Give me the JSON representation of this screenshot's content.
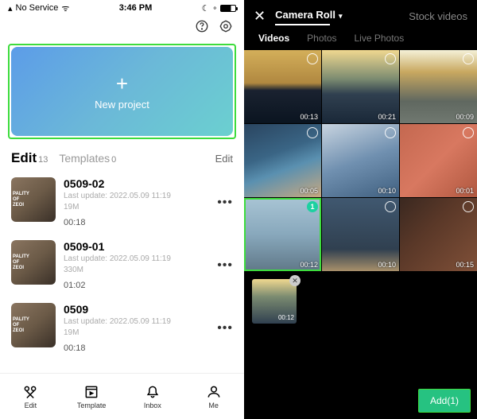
{
  "statusbar": {
    "carrier": "No Service",
    "time": "3:46 PM"
  },
  "new_project_label": "New project",
  "tabs": {
    "edit": "Edit",
    "edit_count": "13",
    "templates": "Templates",
    "templates_count": "0",
    "edit_btn": "Edit"
  },
  "projects": [
    {
      "title": "0509-02",
      "updated": "Last update: 2022.05.09 11:19",
      "size": "19M",
      "duration": "00:18"
    },
    {
      "title": "0509-01",
      "updated": "Last update: 2022.05.09 11:19",
      "size": "330M",
      "duration": "01:02"
    },
    {
      "title": "0509",
      "updated": "Last update: 2022.05.09 11:19",
      "size": "19M",
      "duration": "00:18"
    }
  ],
  "nav": {
    "edit": "Edit",
    "template": "Template",
    "inbox": "Inbox",
    "me": "Me"
  },
  "picker": {
    "source": "Camera Roll",
    "stock": "Stock videos",
    "tabs": {
      "videos": "Videos",
      "photos": "Photos",
      "live": "Live Photos"
    },
    "cells": [
      {
        "duration": "00:13",
        "selected": false
      },
      {
        "duration": "00:21",
        "selected": false
      },
      {
        "duration": "00:09",
        "selected": false
      },
      {
        "duration": "00:05",
        "selected": false
      },
      {
        "duration": "00:10",
        "selected": false
      },
      {
        "duration": "00:01",
        "selected": false
      },
      {
        "duration": "00:12",
        "selected": true,
        "badge": "1"
      },
      {
        "duration": "00:10",
        "selected": false
      },
      {
        "duration": "00:15",
        "selected": false
      }
    ],
    "tray_duration": "00:12",
    "add_label": "Add(1)"
  }
}
